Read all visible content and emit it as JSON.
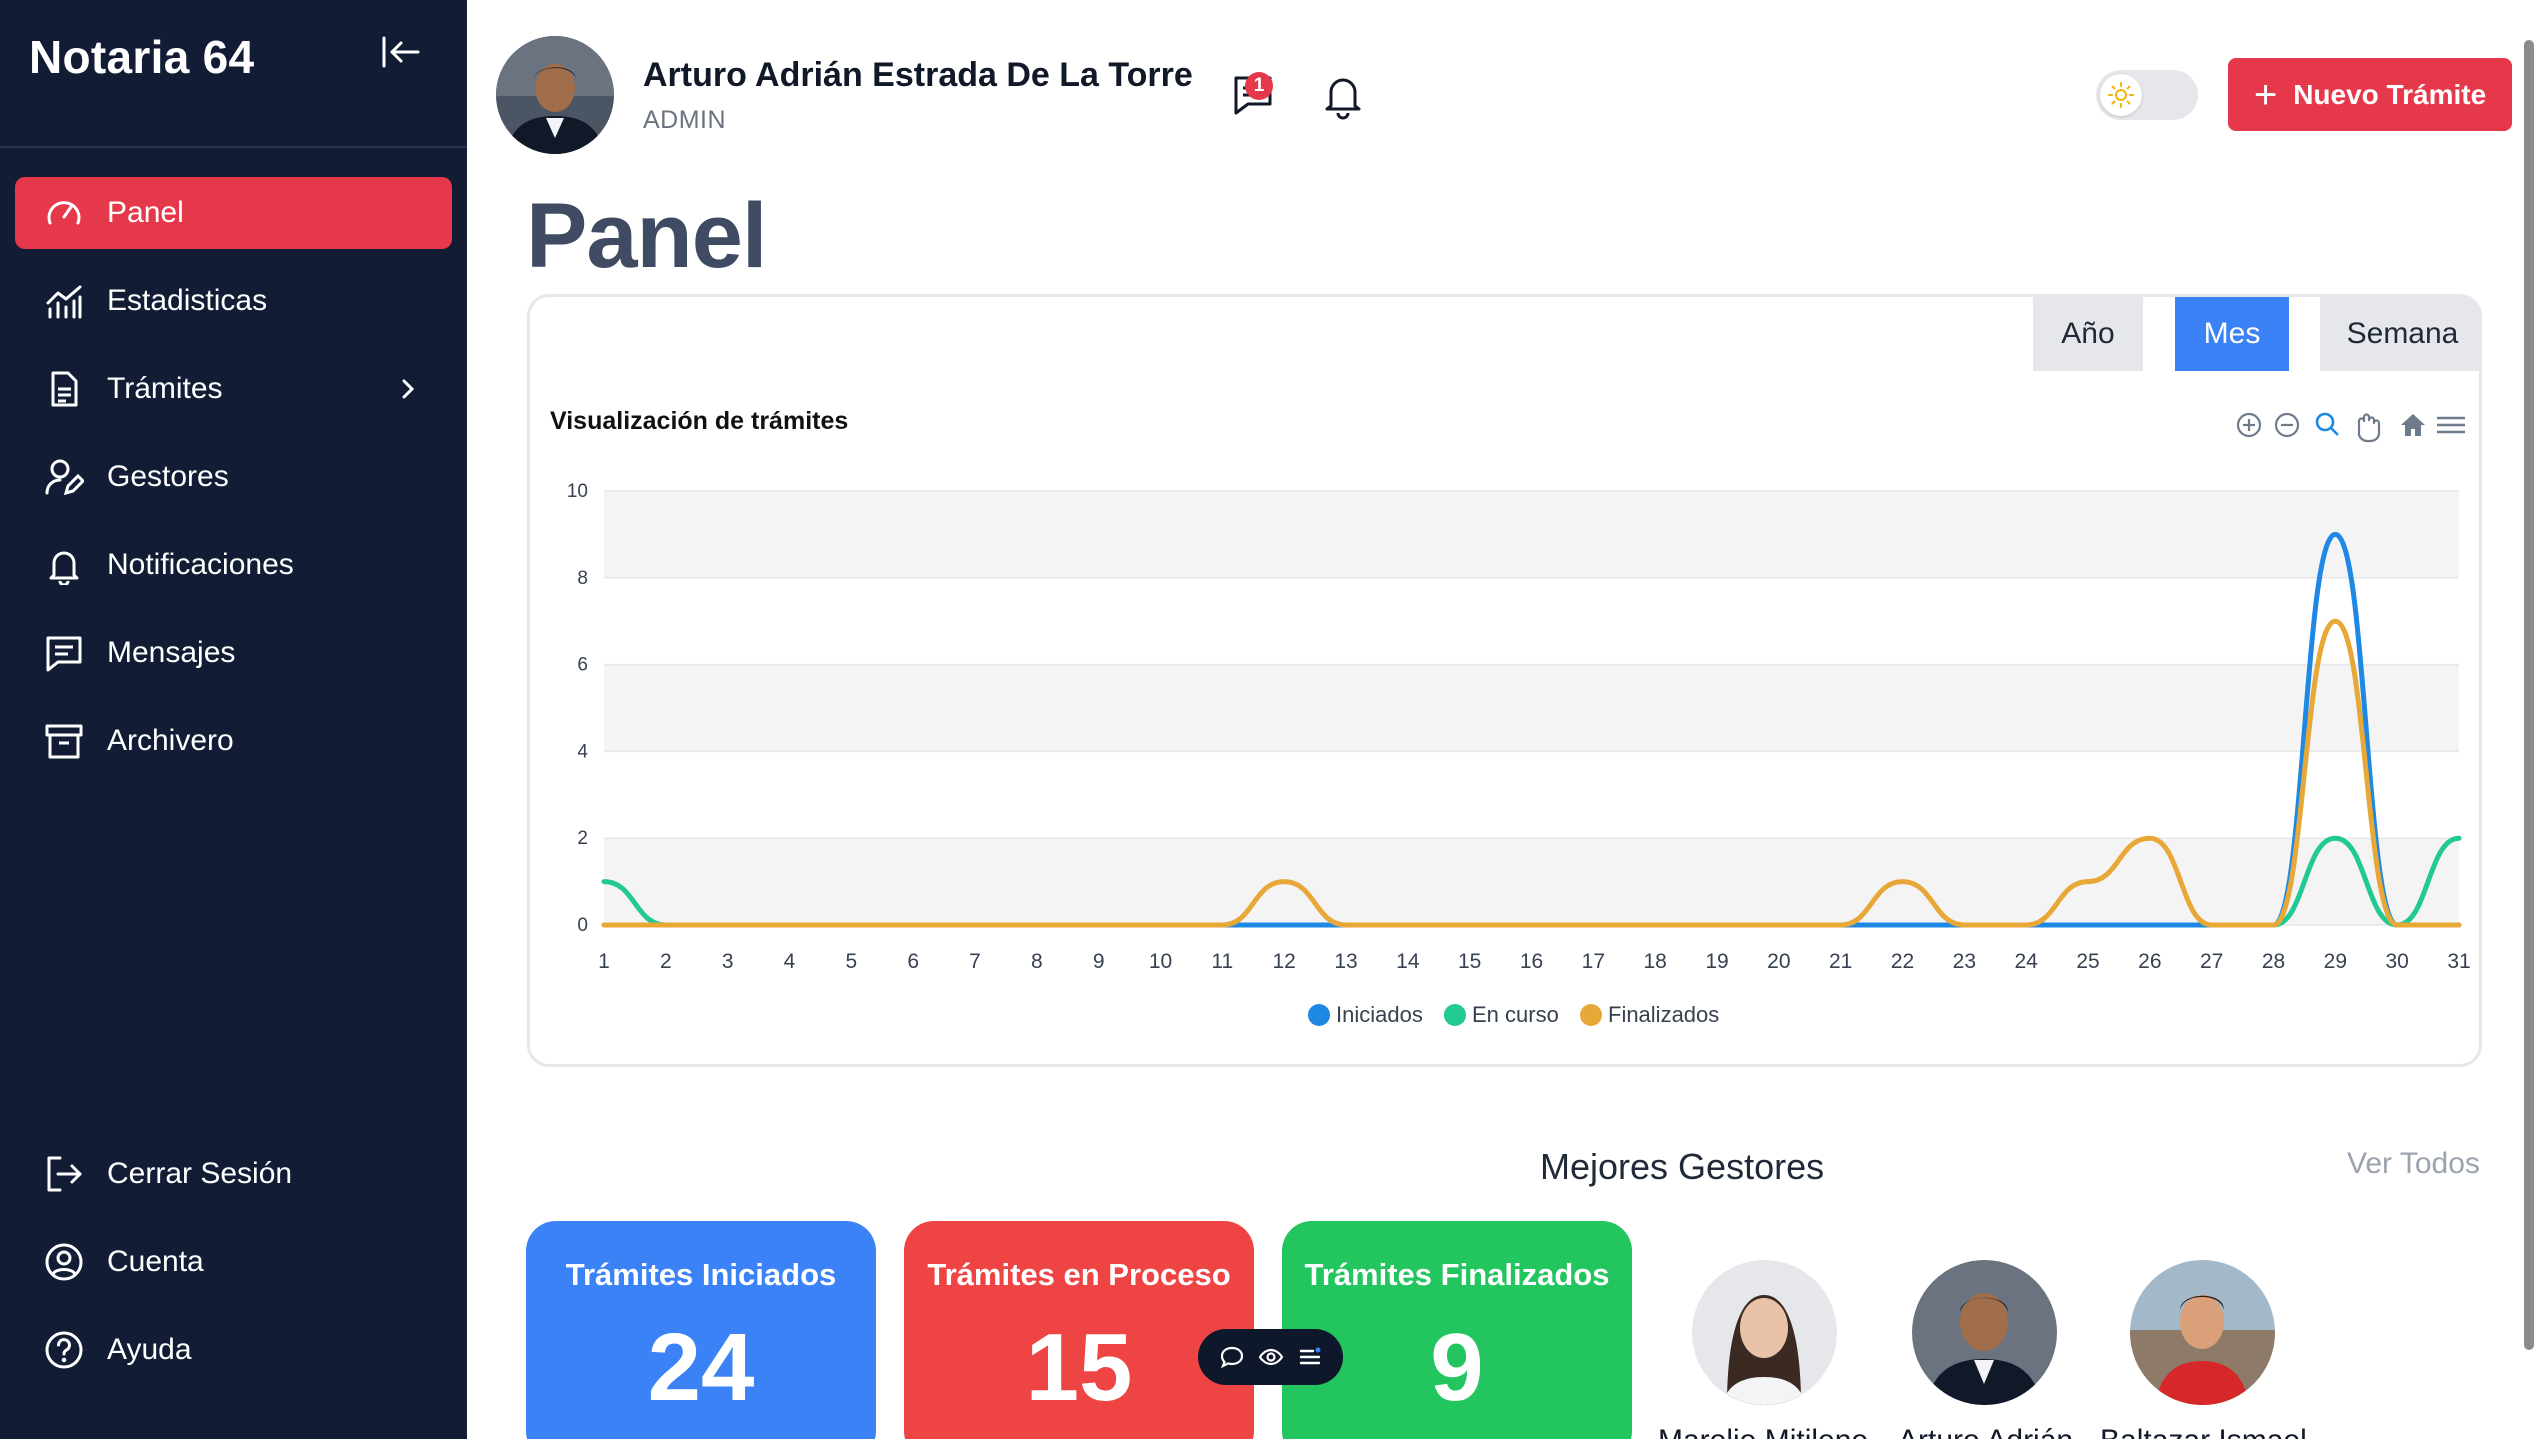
{
  "sidebar": {
    "brand": "Notaria 64",
    "items": [
      {
        "label": "Panel",
        "icon": "gauge-icon",
        "active": true
      },
      {
        "label": "Estadisticas",
        "icon": "chart-icon"
      },
      {
        "label": "Trámites",
        "icon": "document-icon"
      },
      {
        "label": "Gestores",
        "icon": "user-edit-icon"
      },
      {
        "label": "Notificaciones",
        "icon": "bell-icon"
      },
      {
        "label": "Mensajes",
        "icon": "message-icon"
      },
      {
        "label": "Archivero",
        "icon": "archive-icon"
      }
    ],
    "bottom": [
      {
        "label": "Cerrar Sesión",
        "icon": "logout-icon"
      },
      {
        "label": "Cuenta",
        "icon": "account-icon"
      },
      {
        "label": "Ayuda",
        "icon": "help-icon"
      }
    ]
  },
  "header": {
    "user_name": "Arturo Adrián Estrada De La Torre",
    "user_role": "ADMIN",
    "messages_badge": "1",
    "new_button_label": "Nuevo Trámite"
  },
  "page": {
    "title": "Panel"
  },
  "chart_card": {
    "periods": [
      "Año",
      "Mes",
      "Semana"
    ],
    "selected_period": "Mes"
  },
  "chart_data": {
    "type": "line",
    "title": "Visualización de trámites",
    "xlabel": "",
    "ylabel": "",
    "x": [
      1,
      2,
      3,
      4,
      5,
      6,
      7,
      8,
      9,
      10,
      11,
      12,
      13,
      14,
      15,
      16,
      17,
      18,
      19,
      20,
      21,
      22,
      23,
      24,
      25,
      26,
      27,
      28,
      29,
      30,
      31
    ],
    "ylim": [
      0,
      10
    ],
    "yticks": [
      0,
      2,
      4,
      6,
      8,
      10
    ],
    "grid": true,
    "legend_position": "bottom",
    "series": [
      {
        "name": "Iniciados",
        "color": "#1e88e5",
        "values": [
          0,
          0,
          0,
          0,
          0,
          0,
          0,
          0,
          0,
          0,
          0,
          0,
          0,
          0,
          0,
          0,
          0,
          0,
          0,
          0,
          0,
          0,
          0,
          0,
          0,
          0,
          0,
          0,
          9,
          0,
          0
        ]
      },
      {
        "name": "En curso",
        "color": "#22c993",
        "values": [
          1,
          0,
          0,
          0,
          0,
          0,
          0,
          0,
          0,
          0,
          0,
          0,
          0,
          0,
          0,
          0,
          0,
          0,
          0,
          0,
          0,
          0,
          0,
          0,
          0,
          0,
          0,
          0,
          2,
          0,
          2
        ]
      },
      {
        "name": "Finalizados",
        "color": "#e8a838",
        "values": [
          0,
          0,
          0,
          0,
          0,
          0,
          0,
          0,
          0,
          0,
          0,
          1,
          0,
          0,
          0,
          0,
          0,
          0,
          0,
          0,
          0,
          1,
          0,
          0,
          1,
          2,
          0,
          0,
          7,
          0,
          0
        ]
      }
    ]
  },
  "best": {
    "title": "Mejores Gestores",
    "see_all": "Ver Todos",
    "stats": [
      {
        "title": "Trámites Iniciados",
        "value": "24"
      },
      {
        "title": "Trámites en Proceso",
        "value": "15"
      },
      {
        "title": "Trámites Finalizados",
        "value": "9"
      }
    ],
    "gestores": [
      {
        "name": "Marelie Mitilene"
      },
      {
        "name": "Arturo Adrián"
      },
      {
        "name": "Baltazar Ismael"
      }
    ]
  }
}
